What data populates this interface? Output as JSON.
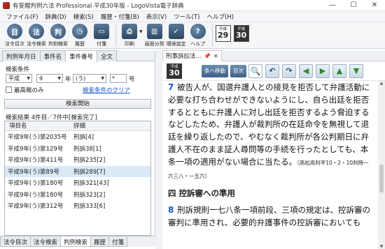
{
  "window": {
    "title": "有斐閣判例六法 Professional 平成30年版 - LogoVista電子辞典",
    "minimize": "—",
    "maximize": "☐",
    "close": "✕"
  },
  "menu": [
    "ファイル(F)",
    "辞典(D)",
    "検索(S)",
    "履歴・付箋(B)",
    "表示(V)",
    "ツール(T)",
    "ヘルプ(H)"
  ],
  "toolbar": {
    "buttons": [
      {
        "label": "法令目次",
        "glyph": "目"
      },
      {
        "label": "法令検索",
        "glyph": "法"
      },
      {
        "label": "判例検索",
        "glyph": "判"
      },
      {
        "label": "履歴",
        "glyph": "◷"
      },
      {
        "label": "付箋",
        "glyph": "▭"
      },
      {
        "label": "印刷",
        "glyph": "⎙"
      },
      {
        "label": "画面分割",
        "glyph": "▥"
      },
      {
        "label": "環境設定",
        "glyph": "✓"
      },
      {
        "label": "ヘルプ",
        "glyph": "?"
      }
    ],
    "era_boxes": [
      {
        "small": "平成",
        "num": "29"
      },
      {
        "small": "平成",
        "num": "30"
      }
    ]
  },
  "left": {
    "top_tabs": [
      "判例年月日",
      "事件名",
      "事件番号",
      "全文"
    ],
    "active_tab": 2,
    "conditions_label": "検索条件",
    "era_select": "平成",
    "year_value": "9",
    "year_label": "年",
    "code_select": "(う)",
    "star_value": "*",
    "number_label": "号",
    "supreme_label": "最高裁のみ",
    "clear_link": "検索条件のクリア",
    "search_button": "検索開始",
    "result_label": "検索結果  4件目／7件中[検索完了]",
    "columns": [
      "項目名",
      "詳細"
    ],
    "rows": [
      {
        "name": "平成9年(う)第2035号",
        "detail": "刑訴[4]"
      },
      {
        "name": "平成9年(う)第129号",
        "detail": "刑訴38[1]"
      },
      {
        "name": "平成9年(う)第411号",
        "detail": "刑訴235[2]"
      },
      {
        "name": "平成9年(う)第89号",
        "detail": "刑訴289[7]"
      },
      {
        "name": "平成9年(う)第180号",
        "detail": "刑訴321[43]"
      },
      {
        "name": "平成9年(う)第180号",
        "detail": "刑訴323[2]"
      },
      {
        "name": "平成9年(う)第312号",
        "detail": "刑訴333[6]"
      }
    ],
    "selected_row": 3,
    "bottom_tabs": [
      "法令目次",
      "法令検索",
      "判例検索",
      "履歴",
      "付箋"
    ],
    "active_bottom_tab": 2
  },
  "right": {
    "doc_tab": "刑事訴訟法…",
    "era": {
      "small": "平成",
      "num": "30"
    },
    "jump_button": "条へ移動",
    "toc_button": "目次",
    "para1_mark": "7",
    "para1": "被告人が、国選弁護人との接見を拒否して弁護活動に必要な打ち合わせができないようにし、自ら出廷を拒否するとともに弁護人に対し出廷を拒否するよう脅迫するなどしたため、弁護人が裁判所の在廷命令を無視して退廷を繰り返したので、やむなく裁判所が各公判期日に弁護人不在のまま証人尋問等の手続を行ったとしても、本条一項の適用がない場合に当たる。",
    "para1_cite": "（高松高判平10・2・10判時一六三八・一五六）",
    "heading": "四 控訴審への準用",
    "para2_mark": "8",
    "para2": "刑訴規則一七八条一項前段、三項の規定は、控訴審の審判に準用され、必要的弁護事件の控訴審においても"
  }
}
